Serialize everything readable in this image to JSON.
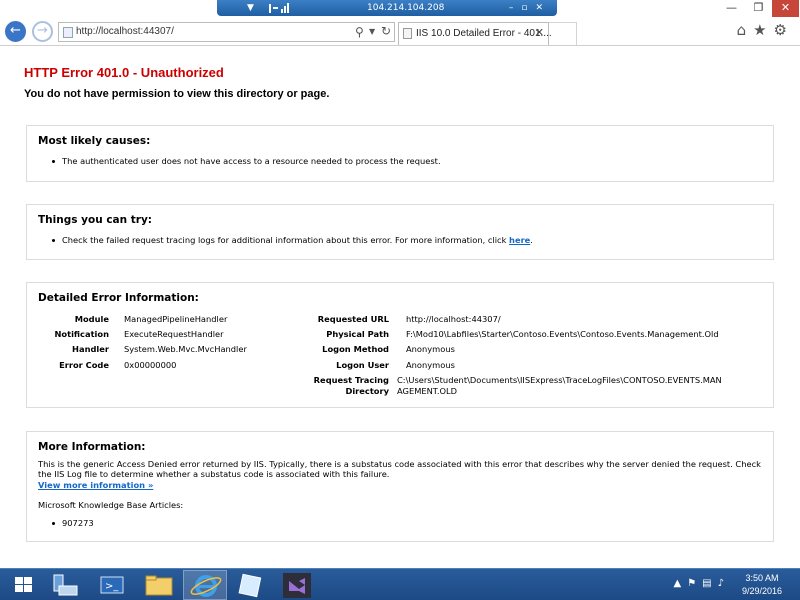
{
  "rdp": {
    "host": "104.214.104.208"
  },
  "browser": {
    "url": "http://localhost:44307/",
    "tab_title": "IIS 10.0 Detailed Error - 401....",
    "window_controls": {
      "minimize": "—",
      "maximize": "❐",
      "close": "✕"
    }
  },
  "page": {
    "title": "HTTP Error 401.0 - Unauthorized",
    "subtitle": "You do not have permission to view this directory or page.",
    "causes": {
      "heading": "Most likely causes:",
      "items": [
        "The authenticated user does not have access to a resource needed to process the request."
      ]
    },
    "try": {
      "heading": "Things you can try:",
      "text": "Check the failed request tracing logs for additional information about this error. For more information, click ",
      "link": "here",
      "end": "."
    },
    "detail": {
      "heading": "Detailed Error Information:",
      "left": [
        {
          "label": "Module",
          "value": "ManagedPipelineHandler"
        },
        {
          "label": "Notification",
          "value": "ExecuteRequestHandler"
        },
        {
          "label": "Handler",
          "value": "System.Web.Mvc.MvcHandler"
        },
        {
          "label": "Error Code",
          "value": "0x00000000"
        }
      ],
      "right": [
        {
          "label": "Requested URL",
          "value": "http://localhost:44307/"
        },
        {
          "label": "Physical Path",
          "value": "F:\\Mod10\\Labfiles\\Starter\\Contoso.Events\\Contoso.Events.Management.Old"
        },
        {
          "label": "Logon Method",
          "value": "Anonymous"
        },
        {
          "label": "Logon User",
          "value": "Anonymous"
        }
      ],
      "trace": {
        "label1": "Request Tracing",
        "label2": "Directory",
        "value1": "C:\\Users\\Student\\Documents\\IISExpress\\TraceLogFiles\\CONTOSO.EVENTS.MAN",
        "value2": "AGEMENT.OLD"
      }
    },
    "more": {
      "heading": "More Information:",
      "text": "This is the generic Access Denied error returned by IIS. Typically, there is a substatus code associated with this error that describes why the server denied the request. Check the IIS Log file to determine whether a substatus code is associated with this failure.",
      "link": "View more information »",
      "kb_label": "Microsoft Knowledge Base Articles:",
      "kb_items": [
        "907273"
      ]
    }
  },
  "taskbar": {
    "time": "3:50 AM",
    "date": "9/29/2016"
  }
}
